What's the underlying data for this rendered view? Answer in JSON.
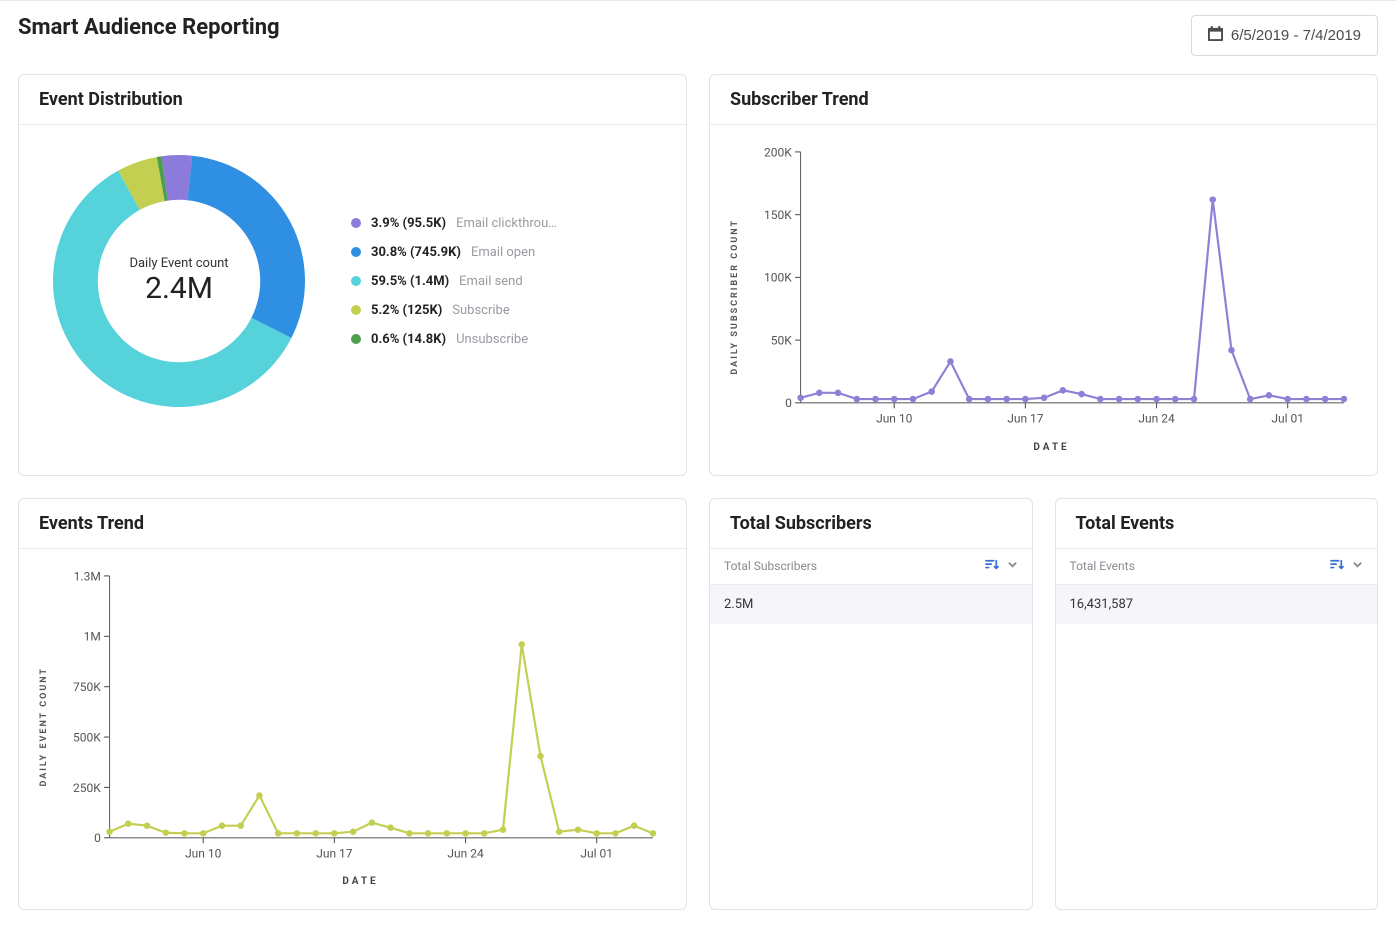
{
  "header": {
    "title": "Smart Audience Reporting",
    "date_range": "6/5/2019 - 7/4/2019"
  },
  "colors": {
    "purple": "#8d7bdc",
    "blue": "#2f8fe3",
    "cyan": "#55d2da",
    "olive": "#c3cf51",
    "green": "#4c9f4c",
    "line_purple": "#8b82d6",
    "line_olive": "#c3cf51"
  },
  "event_distribution": {
    "title": "Event Distribution",
    "center_label": "Daily Event count",
    "center_value": "2.4M",
    "legend": [
      {
        "pct": "3.9%",
        "count": "(95.5K)",
        "name": "Email clickthrou…",
        "color": "purple"
      },
      {
        "pct": "30.8%",
        "count": "(745.9K)",
        "name": "Email open",
        "color": "blue"
      },
      {
        "pct": "59.5%",
        "count": "(1.4M)",
        "name": "Email send",
        "color": "cyan"
      },
      {
        "pct": "5.2%",
        "count": "(125K)",
        "name": "Subscribe",
        "color": "olive"
      },
      {
        "pct": "0.6%",
        "count": "(14.8K)",
        "name": "Unsubscribe",
        "color": "green"
      }
    ]
  },
  "subscriber_trend": {
    "title": "Subscriber Trend",
    "y_title": "DAILY SUBSCRIBER COUNT",
    "x_title": "DATE"
  },
  "events_trend": {
    "title": "Events Trend",
    "y_title": "DAILY EVENT COUNT",
    "x_title": "DATE"
  },
  "total_subscribers": {
    "title": "Total Subscribers",
    "column": "Total Subscribers",
    "value": "2.5M"
  },
  "total_events": {
    "title": "Total Events",
    "column": "Total Events",
    "value": "16,431,587"
  },
  "chart_data": [
    {
      "id": "event_distribution",
      "type": "pie",
      "title": "Event Distribution",
      "total_label": "Daily Event count",
      "total_value": 2400000,
      "series": [
        {
          "name": "Email clickthrough",
          "pct": 3.9,
          "value": 95500
        },
        {
          "name": "Email open",
          "pct": 30.8,
          "value": 745900
        },
        {
          "name": "Email send",
          "pct": 59.5,
          "value": 1400000
        },
        {
          "name": "Subscribe",
          "pct": 5.2,
          "value": 125000
        },
        {
          "name": "Unsubscribe",
          "pct": 0.6,
          "value": 14800
        }
      ]
    },
    {
      "id": "subscriber_trend",
      "type": "line",
      "title": "Subscriber Trend",
      "xlabel": "DATE",
      "ylabel": "DAILY SUBSCRIBER COUNT",
      "ylim": [
        0,
        200000
      ],
      "y_ticks": [
        0,
        50000,
        100000,
        150000,
        200000
      ],
      "x_tick_indices": [
        5,
        12,
        19,
        26
      ],
      "x_tick_labels": [
        "Jun 10",
        "Jun 17",
        "Jun 24",
        "Jul 01"
      ],
      "x": [
        "Jun 05",
        "Jun 06",
        "Jun 07",
        "Jun 08",
        "Jun 09",
        "Jun 10",
        "Jun 11",
        "Jun 12",
        "Jun 13",
        "Jun 14",
        "Jun 15",
        "Jun 16",
        "Jun 17",
        "Jun 18",
        "Jun 19",
        "Jun 20",
        "Jun 21",
        "Jun 22",
        "Jun 23",
        "Jun 24",
        "Jun 25",
        "Jun 26",
        "Jun 27",
        "Jun 28",
        "Jun 29",
        "Jun 30",
        "Jul 01",
        "Jul 02",
        "Jul 03",
        "Jul 04"
      ],
      "values": [
        4000,
        8000,
        8000,
        3000,
        3000,
        3000,
        3000,
        9000,
        33000,
        3000,
        3000,
        3000,
        3000,
        4000,
        10000,
        7000,
        3000,
        3000,
        3000,
        3000,
        3000,
        3000,
        162000,
        42000,
        3000,
        6000,
        3000,
        3000,
        3000,
        3000
      ]
    },
    {
      "id": "events_trend",
      "type": "line",
      "title": "Events Trend",
      "xlabel": "DATE",
      "ylabel": "DAILY EVENT COUNT",
      "ylim": [
        0,
        1300000
      ],
      "y_ticks": [
        0,
        250000,
        500000,
        750000,
        1000000,
        1300000
      ],
      "x_tick_indices": [
        5,
        12,
        19,
        26
      ],
      "x_tick_labels": [
        "Jun 10",
        "Jun 17",
        "Jun 24",
        "Jul 01"
      ],
      "x": [
        "Jun 05",
        "Jun 06",
        "Jun 07",
        "Jun 08",
        "Jun 09",
        "Jun 10",
        "Jun 11",
        "Jun 12",
        "Jun 13",
        "Jun 14",
        "Jun 15",
        "Jun 16",
        "Jun 17",
        "Jun 18",
        "Jun 19",
        "Jun 20",
        "Jun 21",
        "Jun 22",
        "Jun 23",
        "Jun 24",
        "Jun 25",
        "Jun 26",
        "Jun 27",
        "Jun 28",
        "Jun 29",
        "Jun 30",
        "Jul 01",
        "Jul 02",
        "Jul 03",
        "Jul 04"
      ],
      "values": [
        30000,
        70000,
        60000,
        25000,
        22000,
        22000,
        60000,
        60000,
        210000,
        22000,
        22000,
        22000,
        22000,
        30000,
        75000,
        50000,
        22000,
        22000,
        22000,
        22000,
        22000,
        40000,
        960000,
        405000,
        30000,
        40000,
        22000,
        22000,
        60000,
        22000
      ]
    }
  ]
}
